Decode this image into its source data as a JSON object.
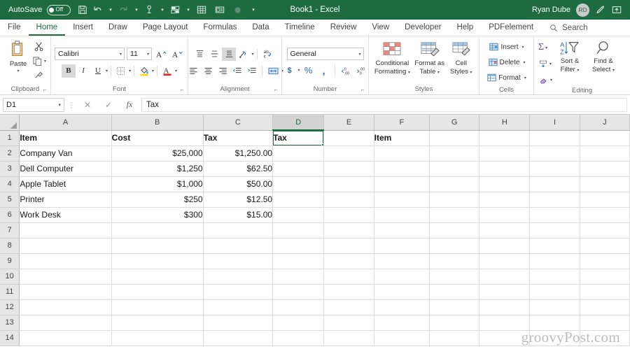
{
  "titlebar": {
    "autosave_label": "AutoSave",
    "autosave_state": "Off",
    "document_title": "Book1  -  Excel",
    "user_name": "Ryan Dube",
    "avatar_initials": "RD",
    "quick_access": [
      {
        "name": "save-icon",
        "label": "Save"
      },
      {
        "name": "undo-icon",
        "label": "Undo"
      },
      {
        "name": "redo-icon",
        "label": "Redo"
      },
      {
        "name": "touch-mode-icon",
        "label": "Touch/Mouse Mode"
      },
      {
        "name": "new-sheet-icon",
        "label": "New"
      },
      {
        "name": "table-icon",
        "label": "Table"
      },
      {
        "name": "form-icon",
        "label": "Form"
      },
      {
        "name": "record-icon",
        "label": "Record"
      },
      {
        "name": "customize-qat-icon",
        "label": "Customize Quick Access Toolbar"
      }
    ],
    "pen_icon": "pen-icon",
    "ribbon_display_icon": "ribbon-display-options-icon",
    "accent_color": "#1e6b41"
  },
  "tabs": {
    "items": [
      {
        "label": "File",
        "active": false
      },
      {
        "label": "Home",
        "active": true
      },
      {
        "label": "Insert",
        "active": false
      },
      {
        "label": "Draw",
        "active": false
      },
      {
        "label": "Page Layout",
        "active": false
      },
      {
        "label": "Formulas",
        "active": false
      },
      {
        "label": "Data",
        "active": false
      },
      {
        "label": "Timeline",
        "active": false
      },
      {
        "label": "Review",
        "active": false
      },
      {
        "label": "View",
        "active": false
      },
      {
        "label": "Developer",
        "active": false
      },
      {
        "label": "Help",
        "active": false
      },
      {
        "label": "PDFelement",
        "active": false
      }
    ],
    "search_label": "Search",
    "search_icon": "search-icon"
  },
  "ribbon": {
    "clipboard": {
      "group_label": "Clipboard",
      "paste_label": "Paste",
      "cut_label": "Cut",
      "copy_label": "Copy",
      "format_painter_label": "Format Painter"
    },
    "font": {
      "group_label": "Font",
      "font_family": "Calibri",
      "font_size": "11",
      "grow_font": "A",
      "shrink_font": "A",
      "bold": "B",
      "italic": "I",
      "underline": "U",
      "borders_label": "Borders",
      "fill_color_label": "Fill Color",
      "font_color_label": "Font Color"
    },
    "alignment": {
      "group_label": "Alignment",
      "top_align": "Top Align",
      "middle_align": "Middle Align",
      "bottom_align": "Bottom Align",
      "orientation": "Orientation",
      "wrap_text": "Wrap Text",
      "align_left": "Align Left",
      "center": "Center",
      "align_right": "Align Right",
      "decrease_indent": "Decrease Indent",
      "increase_indent": "Increase Indent",
      "merge_center": "Merge & Center"
    },
    "number": {
      "group_label": "Number",
      "format": "General",
      "currency": "$",
      "percent": "%",
      "comma": ",",
      "increase_decimal": "Increase Decimal",
      "decrease_decimal": "Decrease Decimal"
    },
    "styles": {
      "group_label": "Styles",
      "conditional_formatting": "Conditional\nFormatting",
      "conditional_line1": "Conditional",
      "conditional_line2": "Formatting",
      "format_table_line1": "Format as",
      "format_table_line2": "Table",
      "cell_styles_line1": "Cell",
      "cell_styles_line2": "Styles"
    },
    "cells": {
      "group_label": "Cells",
      "insert": "Insert",
      "delete": "Delete",
      "format": "Format"
    },
    "editing": {
      "group_label": "Editing",
      "autosum": "Σ",
      "fill_label": "Fill",
      "clear_label": "Clear",
      "sort_line1": "Sort &",
      "sort_line2": "Filter",
      "find_line1": "Find &",
      "find_line2": "Select"
    }
  },
  "formula_bar": {
    "name_box": "D1",
    "cancel_icon": "cancel-icon",
    "enter_icon": "enter-icon",
    "fx_icon": "insert-function-icon",
    "formula_value": "Tax"
  },
  "grid": {
    "columns": [
      "A",
      "B",
      "C",
      "D",
      "E",
      "F",
      "G",
      "H",
      "I",
      "J"
    ],
    "selected_column": "D",
    "selected_cell": "D1",
    "rows": [
      1,
      2,
      3,
      4,
      5,
      6,
      7,
      8,
      9,
      10,
      11,
      12,
      13,
      14
    ],
    "cells": [
      [
        "Item",
        "Cost",
        "Tax",
        "Tax",
        "",
        "Item",
        "",
        "",
        "",
        ""
      ],
      [
        "Company Van",
        "$25,000",
        "$1,250.00",
        "",
        "",
        "",
        "",
        "",
        "",
        ""
      ],
      [
        "Dell Computer",
        "$1,250",
        "$62.50",
        "",
        "",
        "",
        "",
        "",
        "",
        ""
      ],
      [
        "Apple Tablet",
        "$1,000",
        "$50.00",
        "",
        "",
        "",
        "",
        "",
        "",
        ""
      ],
      [
        "Printer",
        "$250",
        "$12.50",
        "",
        "",
        "",
        "",
        "",
        "",
        ""
      ],
      [
        "Work Desk",
        "$300",
        "$15.00",
        "",
        "",
        "",
        "",
        "",
        "",
        ""
      ],
      [
        "",
        "",
        "",
        "",
        "",
        "",
        "",
        "",
        "",
        ""
      ],
      [
        "",
        "",
        "",
        "",
        "",
        "",
        "",
        "",
        "",
        ""
      ],
      [
        "",
        "",
        "",
        "",
        "",
        "",
        "",
        "",
        "",
        ""
      ],
      [
        "",
        "",
        "",
        "",
        "",
        "",
        "",
        "",
        "",
        ""
      ],
      [
        "",
        "",
        "",
        "",
        "",
        "",
        "",
        "",
        "",
        ""
      ],
      [
        "",
        "",
        "",
        "",
        "",
        "",
        "",
        "",
        "",
        ""
      ],
      [
        "",
        "",
        "",
        "",
        "",
        "",
        "",
        "",
        "",
        ""
      ],
      [
        "",
        "",
        "",
        "",
        "",
        "",
        "",
        "",
        "",
        ""
      ]
    ]
  },
  "watermark": "groovyPost.com"
}
